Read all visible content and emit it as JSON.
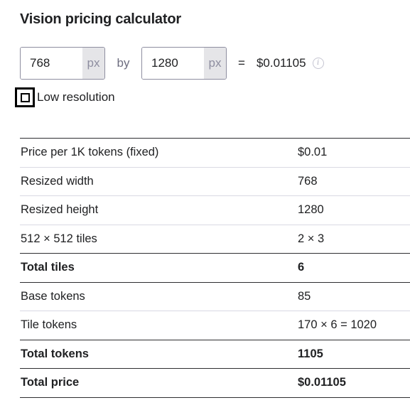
{
  "calculator": {
    "title": "Vision pricing calculator",
    "width_value": "768",
    "height_value": "1280",
    "unit": "px",
    "by_label": "by",
    "equals": "=",
    "price": "$0.01105",
    "info_icon": "info-icon",
    "low_resolution_label": "Low resolution",
    "low_resolution_checked": false
  },
  "table": {
    "rows": [
      {
        "label": "Price per 1K tokens (fixed)",
        "value": "$0.01",
        "bold": false
      },
      {
        "label": "Resized width",
        "value": "768",
        "bold": false
      },
      {
        "label": "Resized height",
        "value": "1280",
        "bold": false
      },
      {
        "label": "512 × 512 tiles",
        "value": "2 × 3",
        "bold": false
      },
      {
        "label": "Total tiles",
        "value": "6",
        "bold": true
      },
      {
        "label": "Base tokens",
        "value": "85",
        "bold": false
      },
      {
        "label": "Tile tokens",
        "value": "170 × 6 = 1020",
        "bold": false
      },
      {
        "label": "Total tokens",
        "value": "1105",
        "bold": true
      },
      {
        "label": "Total price",
        "value": "$0.01105",
        "bold": true
      }
    ]
  }
}
